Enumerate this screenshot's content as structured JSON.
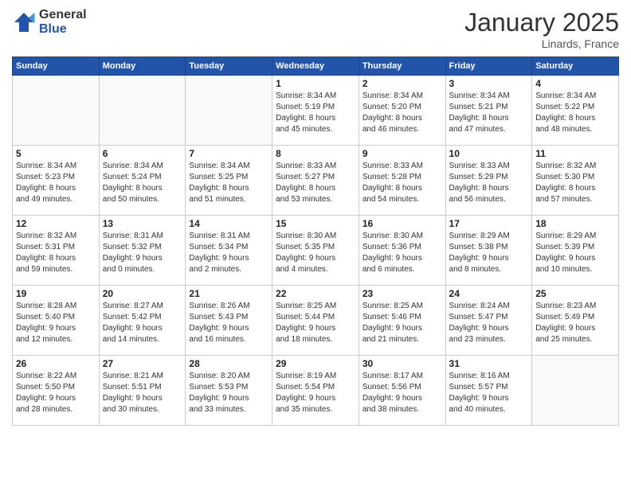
{
  "logo": {
    "general": "General",
    "blue": "Blue"
  },
  "title": "January 2025",
  "subtitle": "Linards, France",
  "days_header": [
    "Sunday",
    "Monday",
    "Tuesday",
    "Wednesday",
    "Thursday",
    "Friday",
    "Saturday"
  ],
  "weeks": [
    [
      {
        "day": "",
        "info": ""
      },
      {
        "day": "",
        "info": ""
      },
      {
        "day": "",
        "info": ""
      },
      {
        "day": "1",
        "info": "Sunrise: 8:34 AM\nSunset: 5:19 PM\nDaylight: 8 hours\nand 45 minutes."
      },
      {
        "day": "2",
        "info": "Sunrise: 8:34 AM\nSunset: 5:20 PM\nDaylight: 8 hours\nand 46 minutes."
      },
      {
        "day": "3",
        "info": "Sunrise: 8:34 AM\nSunset: 5:21 PM\nDaylight: 8 hours\nand 47 minutes."
      },
      {
        "day": "4",
        "info": "Sunrise: 8:34 AM\nSunset: 5:22 PM\nDaylight: 8 hours\nand 48 minutes."
      }
    ],
    [
      {
        "day": "5",
        "info": "Sunrise: 8:34 AM\nSunset: 5:23 PM\nDaylight: 8 hours\nand 49 minutes."
      },
      {
        "day": "6",
        "info": "Sunrise: 8:34 AM\nSunset: 5:24 PM\nDaylight: 8 hours\nand 50 minutes."
      },
      {
        "day": "7",
        "info": "Sunrise: 8:34 AM\nSunset: 5:25 PM\nDaylight: 8 hours\nand 51 minutes."
      },
      {
        "day": "8",
        "info": "Sunrise: 8:33 AM\nSunset: 5:27 PM\nDaylight: 8 hours\nand 53 minutes."
      },
      {
        "day": "9",
        "info": "Sunrise: 8:33 AM\nSunset: 5:28 PM\nDaylight: 8 hours\nand 54 minutes."
      },
      {
        "day": "10",
        "info": "Sunrise: 8:33 AM\nSunset: 5:29 PM\nDaylight: 8 hours\nand 56 minutes."
      },
      {
        "day": "11",
        "info": "Sunrise: 8:32 AM\nSunset: 5:30 PM\nDaylight: 8 hours\nand 57 minutes."
      }
    ],
    [
      {
        "day": "12",
        "info": "Sunrise: 8:32 AM\nSunset: 5:31 PM\nDaylight: 8 hours\nand 59 minutes."
      },
      {
        "day": "13",
        "info": "Sunrise: 8:31 AM\nSunset: 5:32 PM\nDaylight: 9 hours\nand 0 minutes."
      },
      {
        "day": "14",
        "info": "Sunrise: 8:31 AM\nSunset: 5:34 PM\nDaylight: 9 hours\nand 2 minutes."
      },
      {
        "day": "15",
        "info": "Sunrise: 8:30 AM\nSunset: 5:35 PM\nDaylight: 9 hours\nand 4 minutes."
      },
      {
        "day": "16",
        "info": "Sunrise: 8:30 AM\nSunset: 5:36 PM\nDaylight: 9 hours\nand 6 minutes."
      },
      {
        "day": "17",
        "info": "Sunrise: 8:29 AM\nSunset: 5:38 PM\nDaylight: 9 hours\nand 8 minutes."
      },
      {
        "day": "18",
        "info": "Sunrise: 8:29 AM\nSunset: 5:39 PM\nDaylight: 9 hours\nand 10 minutes."
      }
    ],
    [
      {
        "day": "19",
        "info": "Sunrise: 8:28 AM\nSunset: 5:40 PM\nDaylight: 9 hours\nand 12 minutes."
      },
      {
        "day": "20",
        "info": "Sunrise: 8:27 AM\nSunset: 5:42 PM\nDaylight: 9 hours\nand 14 minutes."
      },
      {
        "day": "21",
        "info": "Sunrise: 8:26 AM\nSunset: 5:43 PM\nDaylight: 9 hours\nand 16 minutes."
      },
      {
        "day": "22",
        "info": "Sunrise: 8:25 AM\nSunset: 5:44 PM\nDaylight: 9 hours\nand 18 minutes."
      },
      {
        "day": "23",
        "info": "Sunrise: 8:25 AM\nSunset: 5:46 PM\nDaylight: 9 hours\nand 21 minutes."
      },
      {
        "day": "24",
        "info": "Sunrise: 8:24 AM\nSunset: 5:47 PM\nDaylight: 9 hours\nand 23 minutes."
      },
      {
        "day": "25",
        "info": "Sunrise: 8:23 AM\nSunset: 5:49 PM\nDaylight: 9 hours\nand 25 minutes."
      }
    ],
    [
      {
        "day": "26",
        "info": "Sunrise: 8:22 AM\nSunset: 5:50 PM\nDaylight: 9 hours\nand 28 minutes."
      },
      {
        "day": "27",
        "info": "Sunrise: 8:21 AM\nSunset: 5:51 PM\nDaylight: 9 hours\nand 30 minutes."
      },
      {
        "day": "28",
        "info": "Sunrise: 8:20 AM\nSunset: 5:53 PM\nDaylight: 9 hours\nand 33 minutes."
      },
      {
        "day": "29",
        "info": "Sunrise: 8:19 AM\nSunset: 5:54 PM\nDaylight: 9 hours\nand 35 minutes."
      },
      {
        "day": "30",
        "info": "Sunrise: 8:17 AM\nSunset: 5:56 PM\nDaylight: 9 hours\nand 38 minutes."
      },
      {
        "day": "31",
        "info": "Sunrise: 8:16 AM\nSunset: 5:57 PM\nDaylight: 9 hours\nand 40 minutes."
      },
      {
        "day": "",
        "info": ""
      }
    ]
  ]
}
